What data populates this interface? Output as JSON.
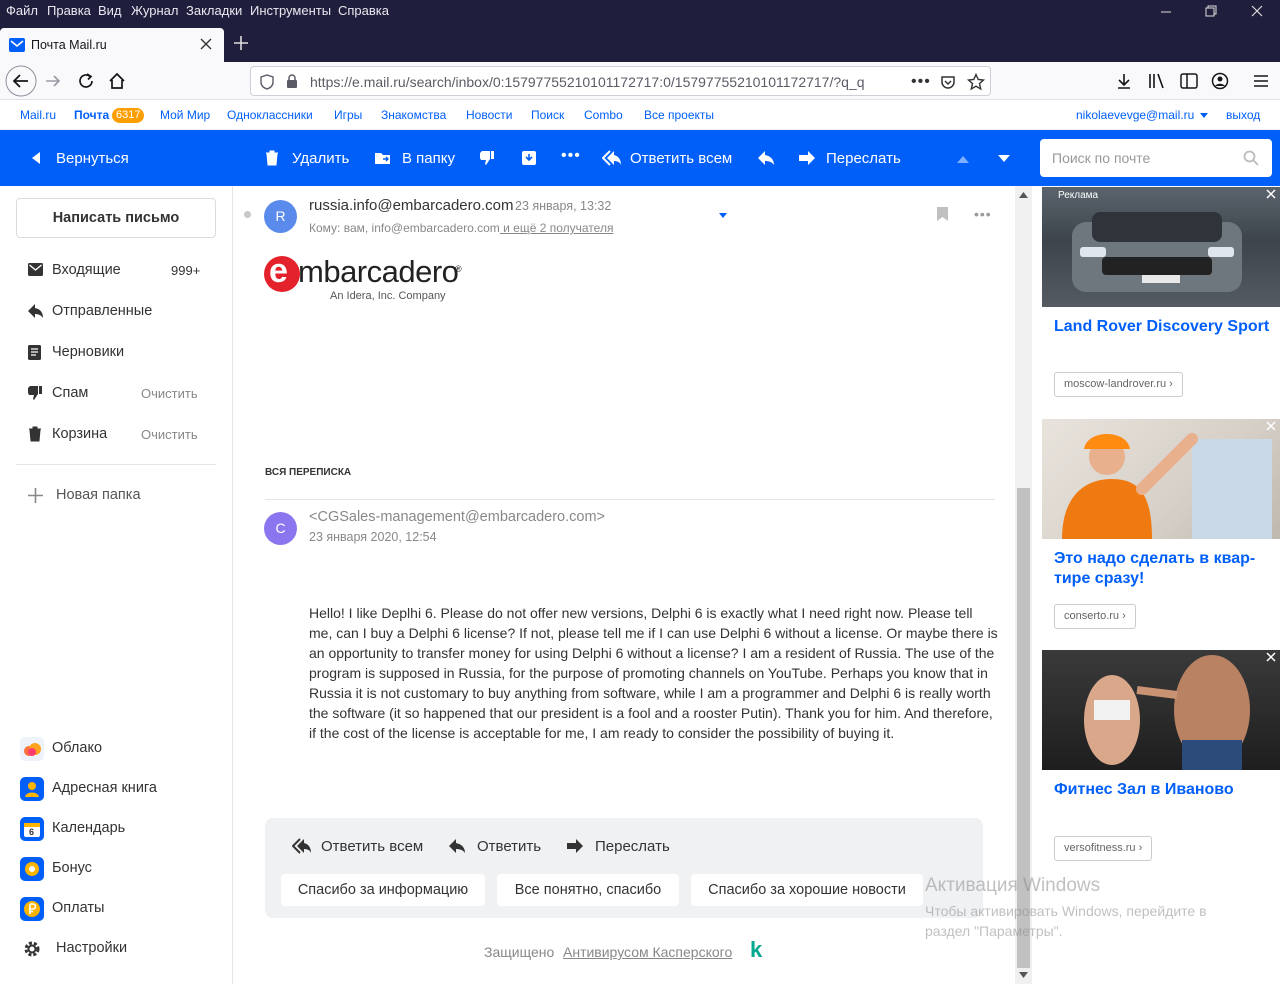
{
  "menubar": [
    "Файл",
    "Правка",
    "Вид",
    "Журнал",
    "Закладки",
    "Инструменты",
    "Справка"
  ],
  "tab": {
    "title": "Почта Mail.ru"
  },
  "urlbar": {
    "url": "https://e.mail.ru/search/inbox/0:15797755210101172717:0/15797755210101172717/?q_q"
  },
  "portal": {
    "links": [
      "Mail.ru",
      "Почта",
      "Мой Мир",
      "Одноклассники",
      "Игры",
      "Знакомства",
      "Новости",
      "Поиск",
      "Combo",
      "Все проекты"
    ],
    "badge": "6317",
    "user": "nikolaevevge@mail.ru",
    "logout": "выход"
  },
  "toolbar": {
    "back": "Вернуться",
    "delete": "Удалить",
    "to_folder": "В папку",
    "reply_all": "Ответить всем",
    "forward": "Переслать",
    "search_placeholder": "Поиск по почте"
  },
  "sidebar": {
    "compose": "Написать письмо",
    "folders": [
      {
        "name": "Входящие",
        "count": "999+"
      },
      {
        "name": "Отправленные"
      },
      {
        "name": "Черновики"
      },
      {
        "name": "Спам",
        "action": "Очистить"
      },
      {
        "name": "Корзина",
        "action": "Очистить"
      }
    ],
    "new_folder": "Новая папка",
    "apps": [
      "Облако",
      "Адресная книга",
      "Календарь",
      "Бонус",
      "Оплаты",
      "Настройки"
    ],
    "calendar_day": "6"
  },
  "message": {
    "avatar": "R",
    "from": "russia.info@embarcadero.com",
    "date": "23 января, 13:32",
    "to_prefix": "Кому: вам, info@embarcadero.com",
    "more_recipients": " и ещё 2 получателя",
    "logo_text": "mbarcadero",
    "logo_e": "e",
    "logo_sub": "An Idera, Inc. Company",
    "thread_label": "ВСЯ ПЕРЕПИСКА",
    "quoted": {
      "avatar": "C",
      "from": "<CGSales-management@embarcadero.com>",
      "date": "23 января 2020, 12:54",
      "body": "Hello! I like Deplhi 6. Please do not offer new versions, Delphi 6 is exactly what I need right now. Please tell me, can I buy a Delphi 6 license? If not, please tell me if I can use Delphi 6 without a license. Or maybe there is an opportunity to transfer money for using Delphi 6 without a license? I am a resident of Russia. The use of the program is supposed in Russia, for the purpose of promoting channels on YouTube. Perhaps you know that in Russia it is not customary to buy anything from software, while I am a programmer and Delphi 6 is really worth the software (it so happened that our president is a fool and a rooster Putin). Thank you for him. And therefore, if the cost of the license is acceptable for me, I am ready to consider the possibility of buying it."
    }
  },
  "reply_panel": {
    "reply_all": "Ответить всем",
    "reply": "Ответить",
    "forward": "Переслать",
    "quick": [
      "Спасибо за информацию",
      "Все понятно, спасибо",
      "Спасибо за хорошие новости"
    ]
  },
  "footer": {
    "protected": "Защищено",
    "av_link": "Антивирусом Касперского",
    "k": "k"
  },
  "ads": {
    "label": "Реклама",
    "items": [
      {
        "title": "Land Rover Discovery Sport",
        "domain": "moscow-landrover.ru ›"
      },
      {
        "title": "Это надо сделать в квар- тире сразу!",
        "domain": "conserto.ru ›"
      },
      {
        "title": "Фитнес Зал в Иваново",
        "domain": "versofitness.ru ›"
      }
    ]
  },
  "watermark": {
    "title": "Активация Windows",
    "line": "Чтобы активировать Windows, перейдите в раздел \"Параметры\"."
  },
  "colors": {
    "accent": "#005ff9",
    "chrome": "#1f1f3d",
    "badge": "#ff9e00"
  }
}
